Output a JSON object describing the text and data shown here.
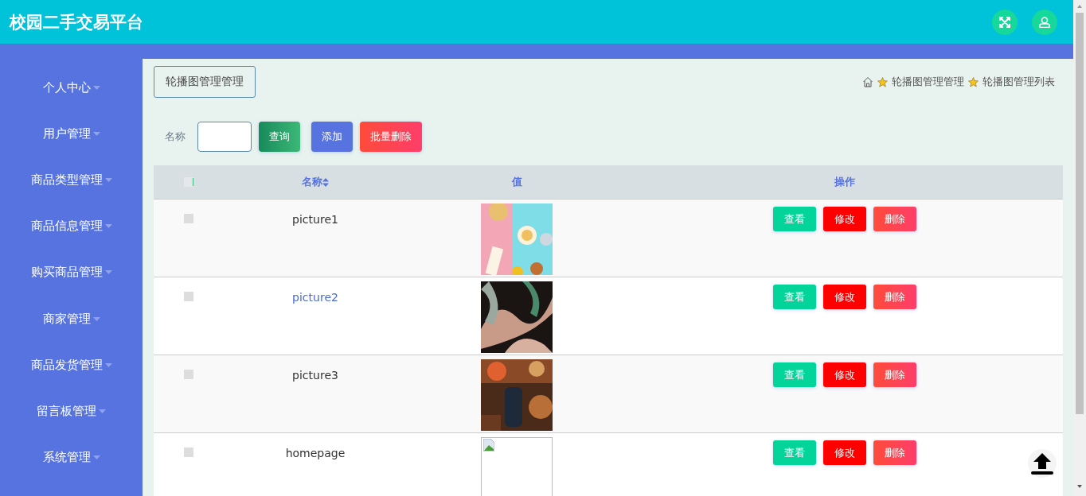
{
  "header": {
    "title": "校园二手交易平台"
  },
  "sidebar": {
    "items": [
      {
        "label": "个人中心"
      },
      {
        "label": "用户管理"
      },
      {
        "label": "商品类型管理"
      },
      {
        "label": "商品信息管理"
      },
      {
        "label": "购买商品管理"
      },
      {
        "label": "商家管理"
      },
      {
        "label": "商品发货管理"
      },
      {
        "label": "留言板管理"
      },
      {
        "label": "系统管理"
      }
    ]
  },
  "page_title": "轮播图管理管理",
  "breadcrumb": [
    "轮播图管理管理",
    "轮播图管理列表"
  ],
  "search": {
    "label": "名称",
    "buttons": [
      {
        "label": "查询",
        "kind": "search"
      },
      {
        "label": "添加",
        "kind": "add"
      },
      {
        "label": "批量删除",
        "kind": "delete"
      }
    ]
  },
  "table": {
    "select_all_checked": false,
    "columns": [
      "名称",
      "值",
      "操作"
    ],
    "rows": [
      {
        "name": "picture1",
        "checked": false,
        "hovered": false,
        "kind": "picture",
        "actions": [
          "查看",
          "修改",
          "删除"
        ]
      },
      {
        "name": "picture2",
        "checked": false,
        "hovered": true,
        "kind": "picture",
        "actions": [
          "查看",
          "修改",
          "删除"
        ]
      },
      {
        "name": "picture3",
        "checked": false,
        "hovered": false,
        "kind": "picture",
        "actions": [
          "查看",
          "修改",
          "删除"
        ]
      },
      {
        "name": "homepage",
        "checked": false,
        "hovered": false,
        "kind": "broken_image",
        "actions": [
          "查看",
          "修改",
          "删除"
        ]
      }
    ]
  }
}
